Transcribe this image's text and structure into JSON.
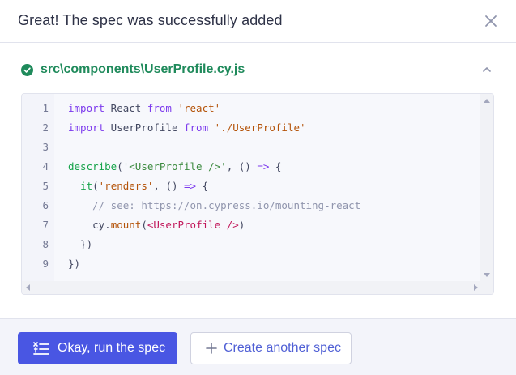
{
  "header": {
    "title": "Great! The spec was successfully added",
    "close_icon": "close-icon"
  },
  "file": {
    "path": "src\\components\\UserProfile.cy.js",
    "status_icon": "check-circle-icon",
    "collapse_icon": "chevron-up-icon"
  },
  "code": {
    "line_numbers": [
      "1",
      "2",
      "3",
      "4",
      "5",
      "6",
      "7",
      "8",
      "9"
    ],
    "lines": [
      "import React from 'react'",
      "import UserProfile from './UserProfile'",
      "",
      "describe('<UserProfile />', () => {",
      "  it('renders', () => {",
      "    // see: https://on.cypress.io/mounting-react",
      "    cy.mount(<UserProfile />)",
      "  })",
      "})"
    ]
  },
  "footer": {
    "primary_label": "Okay, run the spec",
    "primary_icon": "run-list-icon",
    "secondary_label": "Create another spec",
    "secondary_icon": "plus-icon"
  },
  "colors": {
    "accent": "#4956e3",
    "success": "#1f8a5b",
    "text": "#2e3247"
  }
}
